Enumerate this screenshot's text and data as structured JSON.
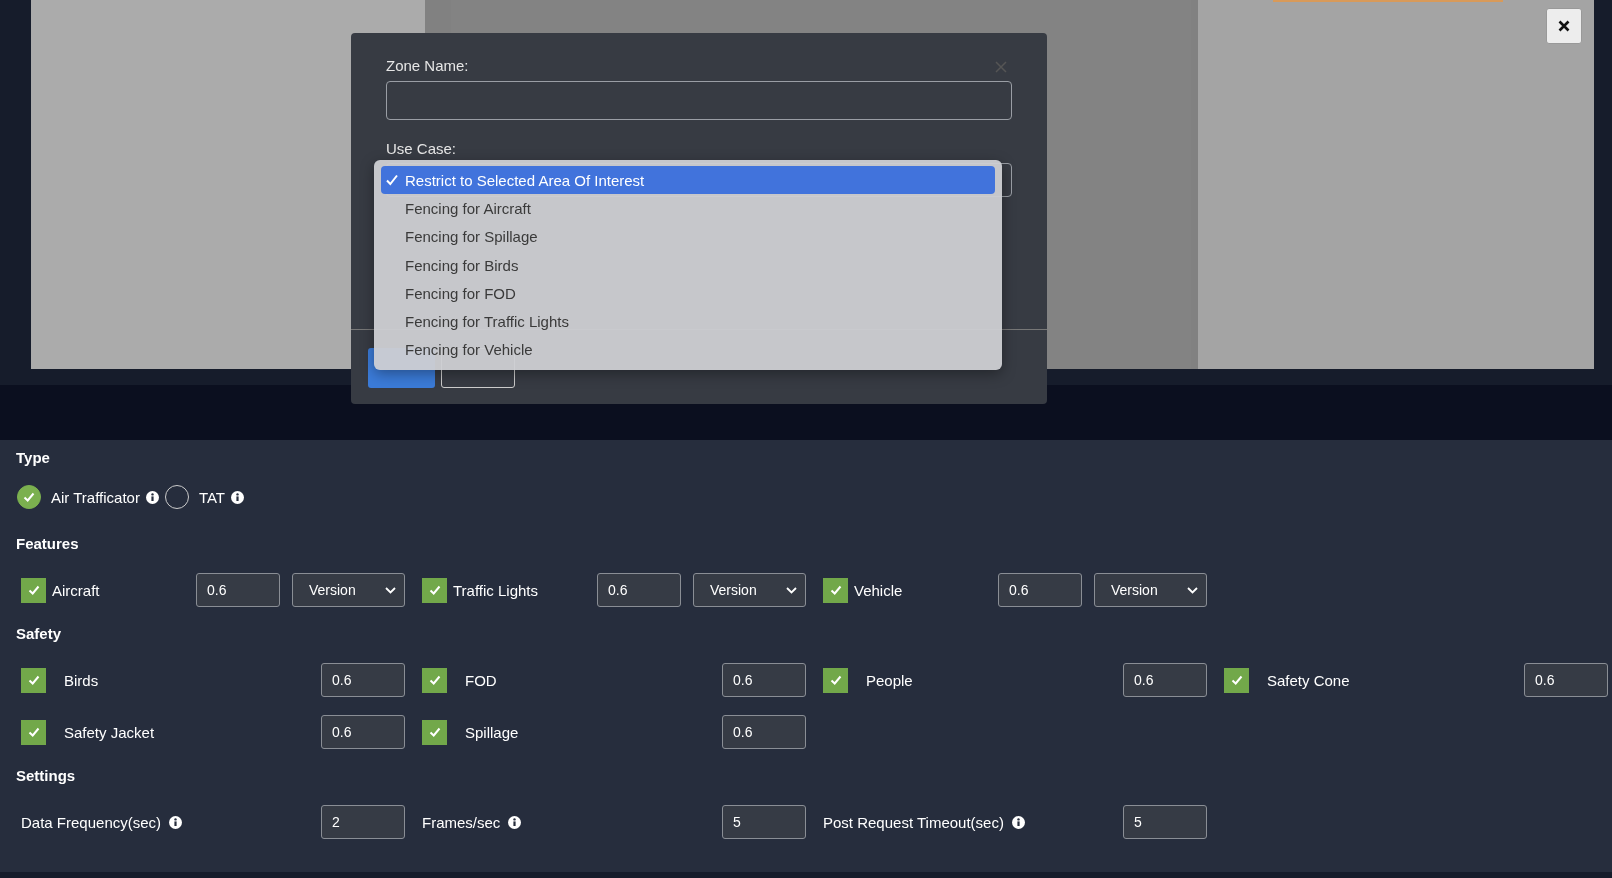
{
  "dialog": {
    "zone_name": {
      "label": "Zone Name:"
    },
    "use_case": {
      "label": "Use Case:",
      "options": [
        {
          "label": "Restrict to Selected Area Of Interest",
          "selected": true
        },
        {
          "label": "Fencing for Aircraft",
          "selected": false
        },
        {
          "label": "Fencing for Spillage",
          "selected": false
        },
        {
          "label": "Fencing for Birds",
          "selected": false
        },
        {
          "label": "Fencing for FOD",
          "selected": false
        },
        {
          "label": "Fencing for Traffic Lights",
          "selected": false
        },
        {
          "label": "Fencing for Vehicle",
          "selected": false
        }
      ]
    }
  },
  "type": {
    "title": "Type",
    "options": [
      {
        "label": "Air Trafficator",
        "selected": true,
        "info": true
      },
      {
        "label": "TAT",
        "selected": false,
        "info": true
      }
    ]
  },
  "features": {
    "title": "Features",
    "items": [
      {
        "label": "Aircraft",
        "checked": true,
        "value": "0.6",
        "version": "Version"
      },
      {
        "label": "Traffic Lights",
        "checked": true,
        "value": "0.6",
        "version": "Version"
      },
      {
        "label": "Vehicle",
        "checked": true,
        "value": "0.6",
        "version": "Version"
      }
    ]
  },
  "safety": {
    "title": "Safety",
    "items": [
      {
        "label": "Birds",
        "checked": true,
        "value": "0.6"
      },
      {
        "label": "FOD",
        "checked": true,
        "value": "0.6"
      },
      {
        "label": "People",
        "checked": true,
        "value": "0.6"
      },
      {
        "label": "Safety Cone",
        "checked": true,
        "value": "0.6"
      },
      {
        "label": "Safety Jacket",
        "checked": true,
        "value": "0.6"
      },
      {
        "label": "Spillage",
        "checked": true,
        "value": "0.6"
      }
    ]
  },
  "settings": {
    "title": "Settings",
    "items": [
      {
        "label": "Data Frequency(sec)",
        "info": true,
        "value": "2"
      },
      {
        "label": "Frames/sec",
        "info": true,
        "value": "5"
      },
      {
        "label": "Post Request Timeout(sec)",
        "info": true,
        "value": "5"
      }
    ]
  }
}
